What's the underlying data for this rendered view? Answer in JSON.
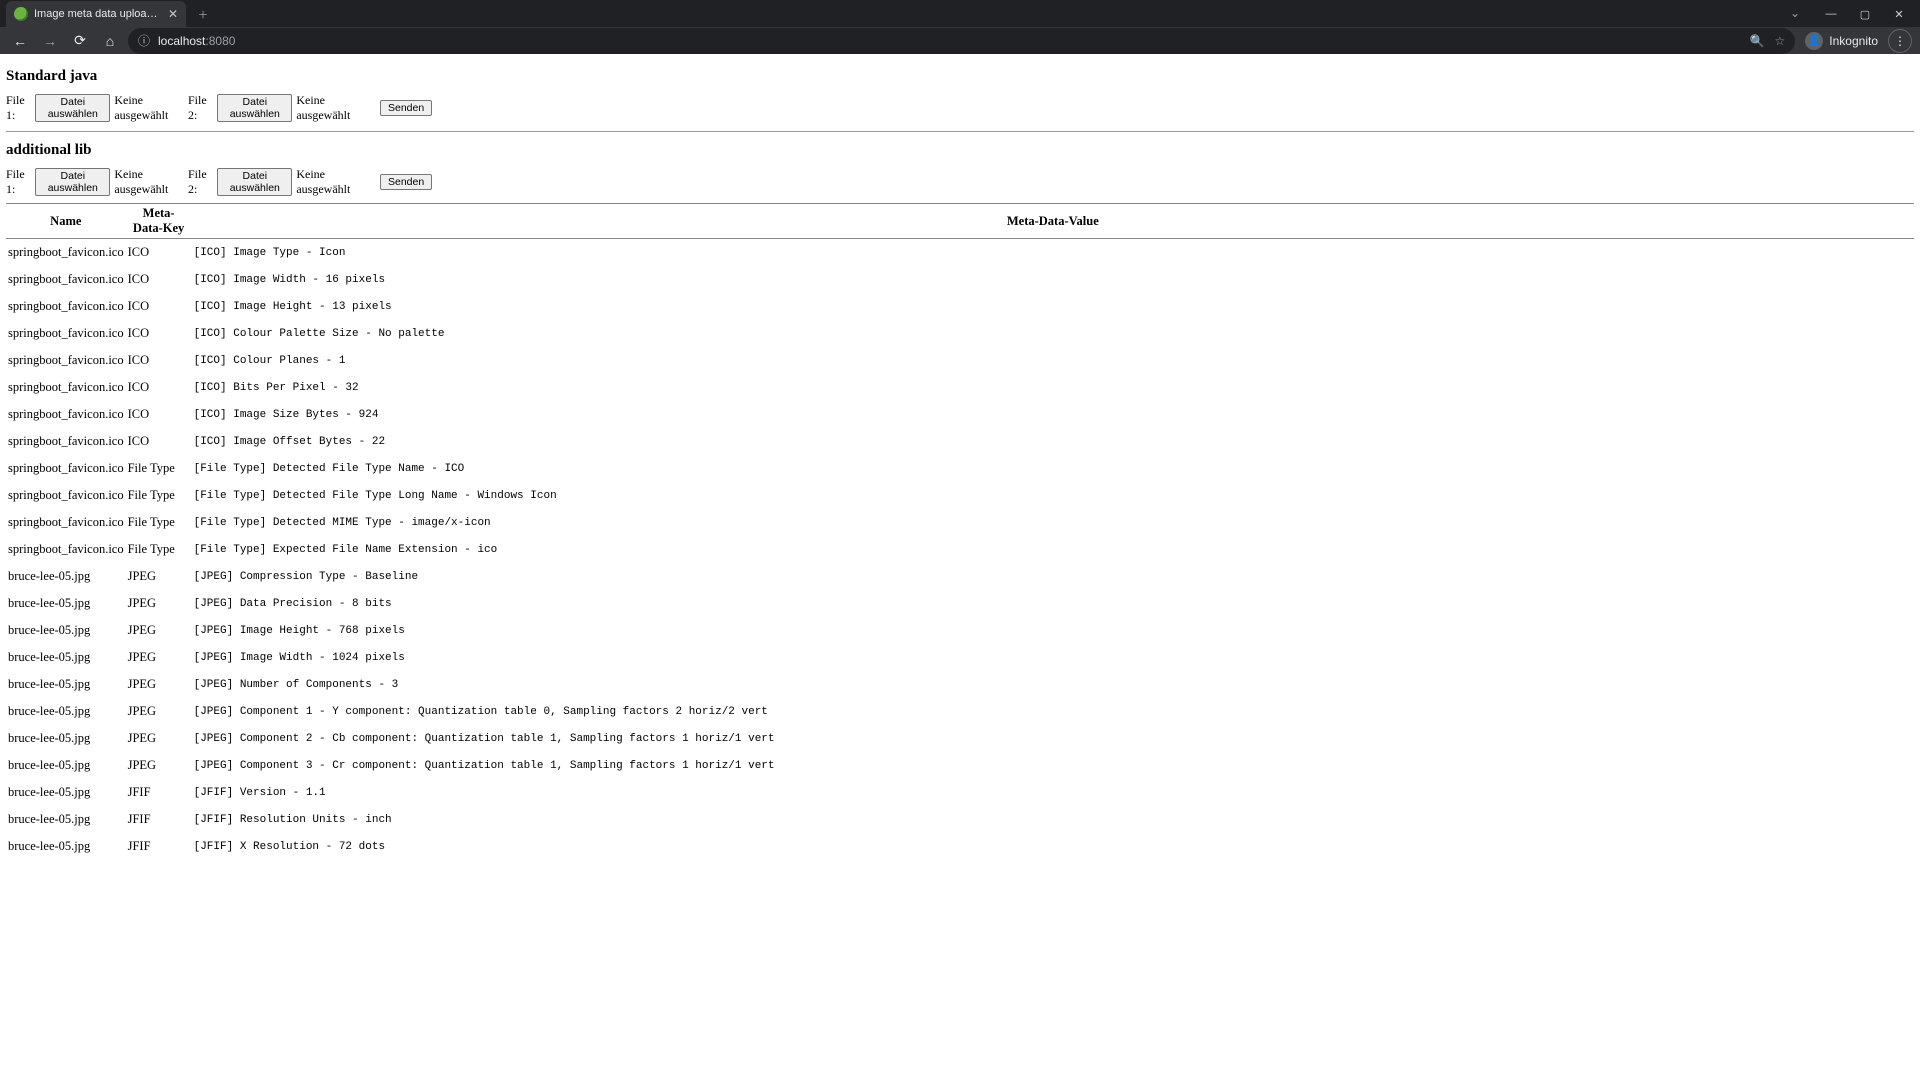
{
  "browser": {
    "tab_title": "Image meta data upload Exampl",
    "url_host": "localhost",
    "url_port": ":8080",
    "profile_label": "Inkognito"
  },
  "sections": {
    "std_title": "Standard java",
    "lib_title": "additional lib",
    "file1_label": "File 1:",
    "file2_label": "File 2:",
    "choose_label": "Datei auswählen",
    "nofile_label": "Keine ausgewählt",
    "submit_label": "Senden"
  },
  "table": {
    "headers": {
      "name": "Name",
      "key": "Meta-Data-Key",
      "value": "Meta-Data-Value"
    },
    "rows": [
      {
        "name": "springboot_favicon.ico",
        "key": "ICO",
        "value": "[ICO] Image Type - Icon"
      },
      {
        "name": "springboot_favicon.ico",
        "key": "ICO",
        "value": "[ICO] Image Width - 16 pixels"
      },
      {
        "name": "springboot_favicon.ico",
        "key": "ICO",
        "value": "[ICO] Image Height - 13 pixels"
      },
      {
        "name": "springboot_favicon.ico",
        "key": "ICO",
        "value": "[ICO] Colour Palette Size - No palette"
      },
      {
        "name": "springboot_favicon.ico",
        "key": "ICO",
        "value": "[ICO] Colour Planes - 1"
      },
      {
        "name": "springboot_favicon.ico",
        "key": "ICO",
        "value": "[ICO] Bits Per Pixel - 32"
      },
      {
        "name": "springboot_favicon.ico",
        "key": "ICO",
        "value": "[ICO] Image Size Bytes - 924"
      },
      {
        "name": "springboot_favicon.ico",
        "key": "ICO",
        "value": "[ICO] Image Offset Bytes - 22"
      },
      {
        "name": "springboot_favicon.ico",
        "key": "File Type",
        "value": "[File Type] Detected File Type Name - ICO"
      },
      {
        "name": "springboot_favicon.ico",
        "key": "File Type",
        "value": "[File Type] Detected File Type Long Name - Windows Icon"
      },
      {
        "name": "springboot_favicon.ico",
        "key": "File Type",
        "value": "[File Type] Detected MIME Type - image/x-icon"
      },
      {
        "name": "springboot_favicon.ico",
        "key": "File Type",
        "value": "[File Type] Expected File Name Extension - ico"
      },
      {
        "name": "bruce-lee-05.jpg",
        "key": "JPEG",
        "value": "[JPEG] Compression Type - Baseline"
      },
      {
        "name": "bruce-lee-05.jpg",
        "key": "JPEG",
        "value": "[JPEG] Data Precision - 8 bits"
      },
      {
        "name": "bruce-lee-05.jpg",
        "key": "JPEG",
        "value": "[JPEG] Image Height - 768 pixels"
      },
      {
        "name": "bruce-lee-05.jpg",
        "key": "JPEG",
        "value": "[JPEG] Image Width - 1024 pixels"
      },
      {
        "name": "bruce-lee-05.jpg",
        "key": "JPEG",
        "value": "[JPEG] Number of Components - 3"
      },
      {
        "name": "bruce-lee-05.jpg",
        "key": "JPEG",
        "value": "[JPEG] Component 1 - Y component: Quantization table 0, Sampling factors 2 horiz/2 vert"
      },
      {
        "name": "bruce-lee-05.jpg",
        "key": "JPEG",
        "value": "[JPEG] Component 2 - Cb component: Quantization table 1, Sampling factors 1 horiz/1 vert"
      },
      {
        "name": "bruce-lee-05.jpg",
        "key": "JPEG",
        "value": "[JPEG] Component 3 - Cr component: Quantization table 1, Sampling factors 1 horiz/1 vert"
      },
      {
        "name": "bruce-lee-05.jpg",
        "key": "JFIF",
        "value": "[JFIF] Version - 1.1"
      },
      {
        "name": "bruce-lee-05.jpg",
        "key": "JFIF",
        "value": "[JFIF] Resolution Units - inch"
      },
      {
        "name": "bruce-lee-05.jpg",
        "key": "JFIF",
        "value": "[JFIF] X Resolution - 72 dots"
      }
    ]
  }
}
